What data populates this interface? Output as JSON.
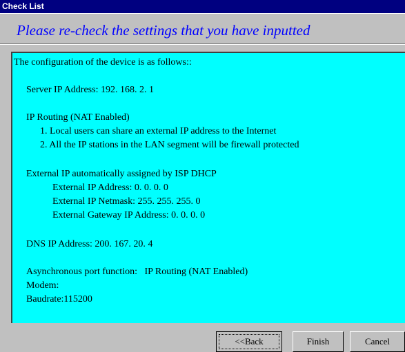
{
  "window": {
    "title": "Check List",
    "subtitle": "Please re-check the settings that you have inputted"
  },
  "config": {
    "intro": "The configuration of the device is as follows::",
    "server_ip": "Server IP Address: 192. 168. 2. 1",
    "routing_heading": "IP Routing (NAT Enabled)",
    "routing_item_1": "1. Local users can share an external IP address to the Internet",
    "routing_item_2": "2. All the IP stations in the LAN segment will be firewall protected",
    "external_heading": "External IP automatically assigned by ISP DHCP",
    "external_ip": "External IP Address: 0. 0. 0. 0",
    "external_netmask": "External IP Netmask: 255. 255. 255. 0",
    "external_gateway": "External Gateway IP Address: 0. 0. 0. 0",
    "dns_ip": "DNS IP Address: 200. 167. 20. 4",
    "async_port": "Asynchronous port function:   IP Routing (NAT Enabled)",
    "modem": "Modem:",
    "baudrate": "Baudrate:115200"
  },
  "buttons": {
    "back": "<<Back",
    "finish": "Finish",
    "cancel": "Cancel"
  }
}
